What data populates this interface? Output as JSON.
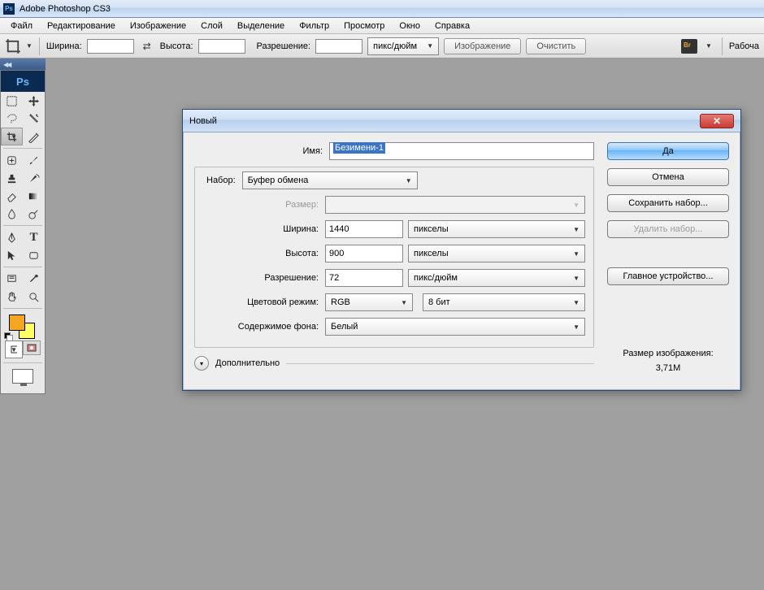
{
  "titlebar": {
    "app_name": "Adobe Photoshop CS3"
  },
  "menu": [
    "Файл",
    "Редактирование",
    "Изображение",
    "Слой",
    "Выделение",
    "Фильтр",
    "Просмотр",
    "Окно",
    "Справка"
  ],
  "optionbar": {
    "width_label": "Ширина:",
    "height_label": "Высота:",
    "resolution_label": "Разрешение:",
    "unit_select": "пикс/дюйм",
    "btn_image": "Изображение",
    "btn_clear": "Очистить",
    "workspace_label": "Рабоча"
  },
  "dialog": {
    "title": "Новый",
    "labels": {
      "name": "Имя:",
      "preset": "Набор:",
      "size": "Размер:",
      "width": "Ширина:",
      "height": "Высота:",
      "resolution": "Разрешение:",
      "color_mode": "Цветовой режим:",
      "background": "Содержимое фона:",
      "advanced": "Дополнительно"
    },
    "values": {
      "name": "Безимени-1",
      "preset": "Буфер обмена",
      "width": "1440",
      "height": "900",
      "resolution": "72",
      "width_unit": "пикселы",
      "height_unit": "пикселы",
      "resolution_unit": "пикс/дюйм",
      "color_mode": "RGB",
      "color_depth": "8 бит",
      "background": "Белый"
    },
    "buttons": {
      "ok": "Да",
      "cancel": "Отмена",
      "save_preset": "Сохранить набор...",
      "delete_preset": "Удалить набор...",
      "device_central": "Главное устройство..."
    },
    "size_info_label": "Размер изображения:",
    "size_info_value": "3,71M"
  }
}
